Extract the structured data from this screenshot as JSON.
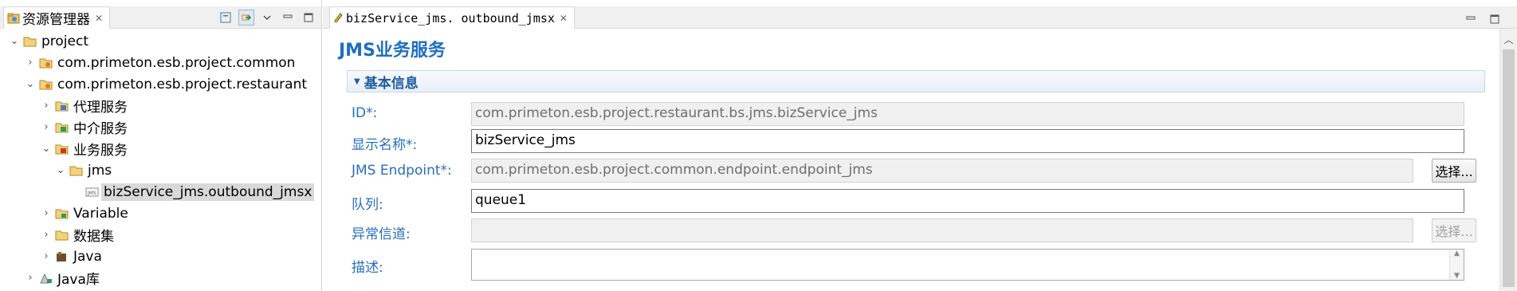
{
  "explorer": {
    "title": "资源管理器",
    "tree": [
      {
        "label": "project",
        "expanded": true,
        "icon": "folder-icon"
      },
      {
        "label": "com.primeton.esb.project.common",
        "expanded": false,
        "icon": "package-folder-icon"
      },
      {
        "label": "com.primeton.esb.project.restaurant",
        "expanded": true,
        "icon": "package-folder-icon"
      },
      {
        "label": "代理服务",
        "expanded": false,
        "icon": "proxy-service-folder-icon"
      },
      {
        "label": "中介服务",
        "expanded": false,
        "icon": "mediation-service-folder-icon"
      },
      {
        "label": "业务服务",
        "expanded": true,
        "icon": "biz-service-folder-icon"
      },
      {
        "label": "jms",
        "expanded": true,
        "icon": "folder-icon"
      },
      {
        "label": "bizService_jms.outbound_jmsx",
        "selected": true,
        "icon": "jms-file-icon"
      },
      {
        "label": "Variable",
        "expanded": false,
        "icon": "variable-folder-icon"
      },
      {
        "label": "数据集",
        "expanded": false,
        "icon": "dataset-folder-icon"
      },
      {
        "label": "Java",
        "expanded": false,
        "icon": "java-folder-icon"
      },
      {
        "label": "Java库",
        "expanded": false,
        "icon": "java-library-icon"
      }
    ]
  },
  "editor": {
    "tab_title": "bizService_jms. outbound_jmsx",
    "form_title": "JMS业务服务",
    "section_title": "基本信息",
    "fields": {
      "id": {
        "label": "ID*:",
        "value": "com.primeton.esb.project.restaurant.bs.jms.bizService_jms"
      },
      "display_name": {
        "label": "显示名称*:",
        "value": "bizService_jms"
      },
      "jms_endpoint": {
        "label": "JMS Endpoint*:",
        "value": "com.primeton.esb.project.common.endpoint.endpoint_jms",
        "button": "选择..."
      },
      "queue": {
        "label": "队列:",
        "value": "queue1"
      },
      "error_channel": {
        "label": "异常信道:",
        "value": "",
        "button": "选择..."
      },
      "description": {
        "label": "描述:",
        "value": ""
      }
    }
  },
  "colors": {
    "label_blue": "#2a6ebc",
    "title_blue": "#1f6fc0",
    "section_blue": "#1f5da0",
    "selection_gray": "#d9d9d9"
  }
}
